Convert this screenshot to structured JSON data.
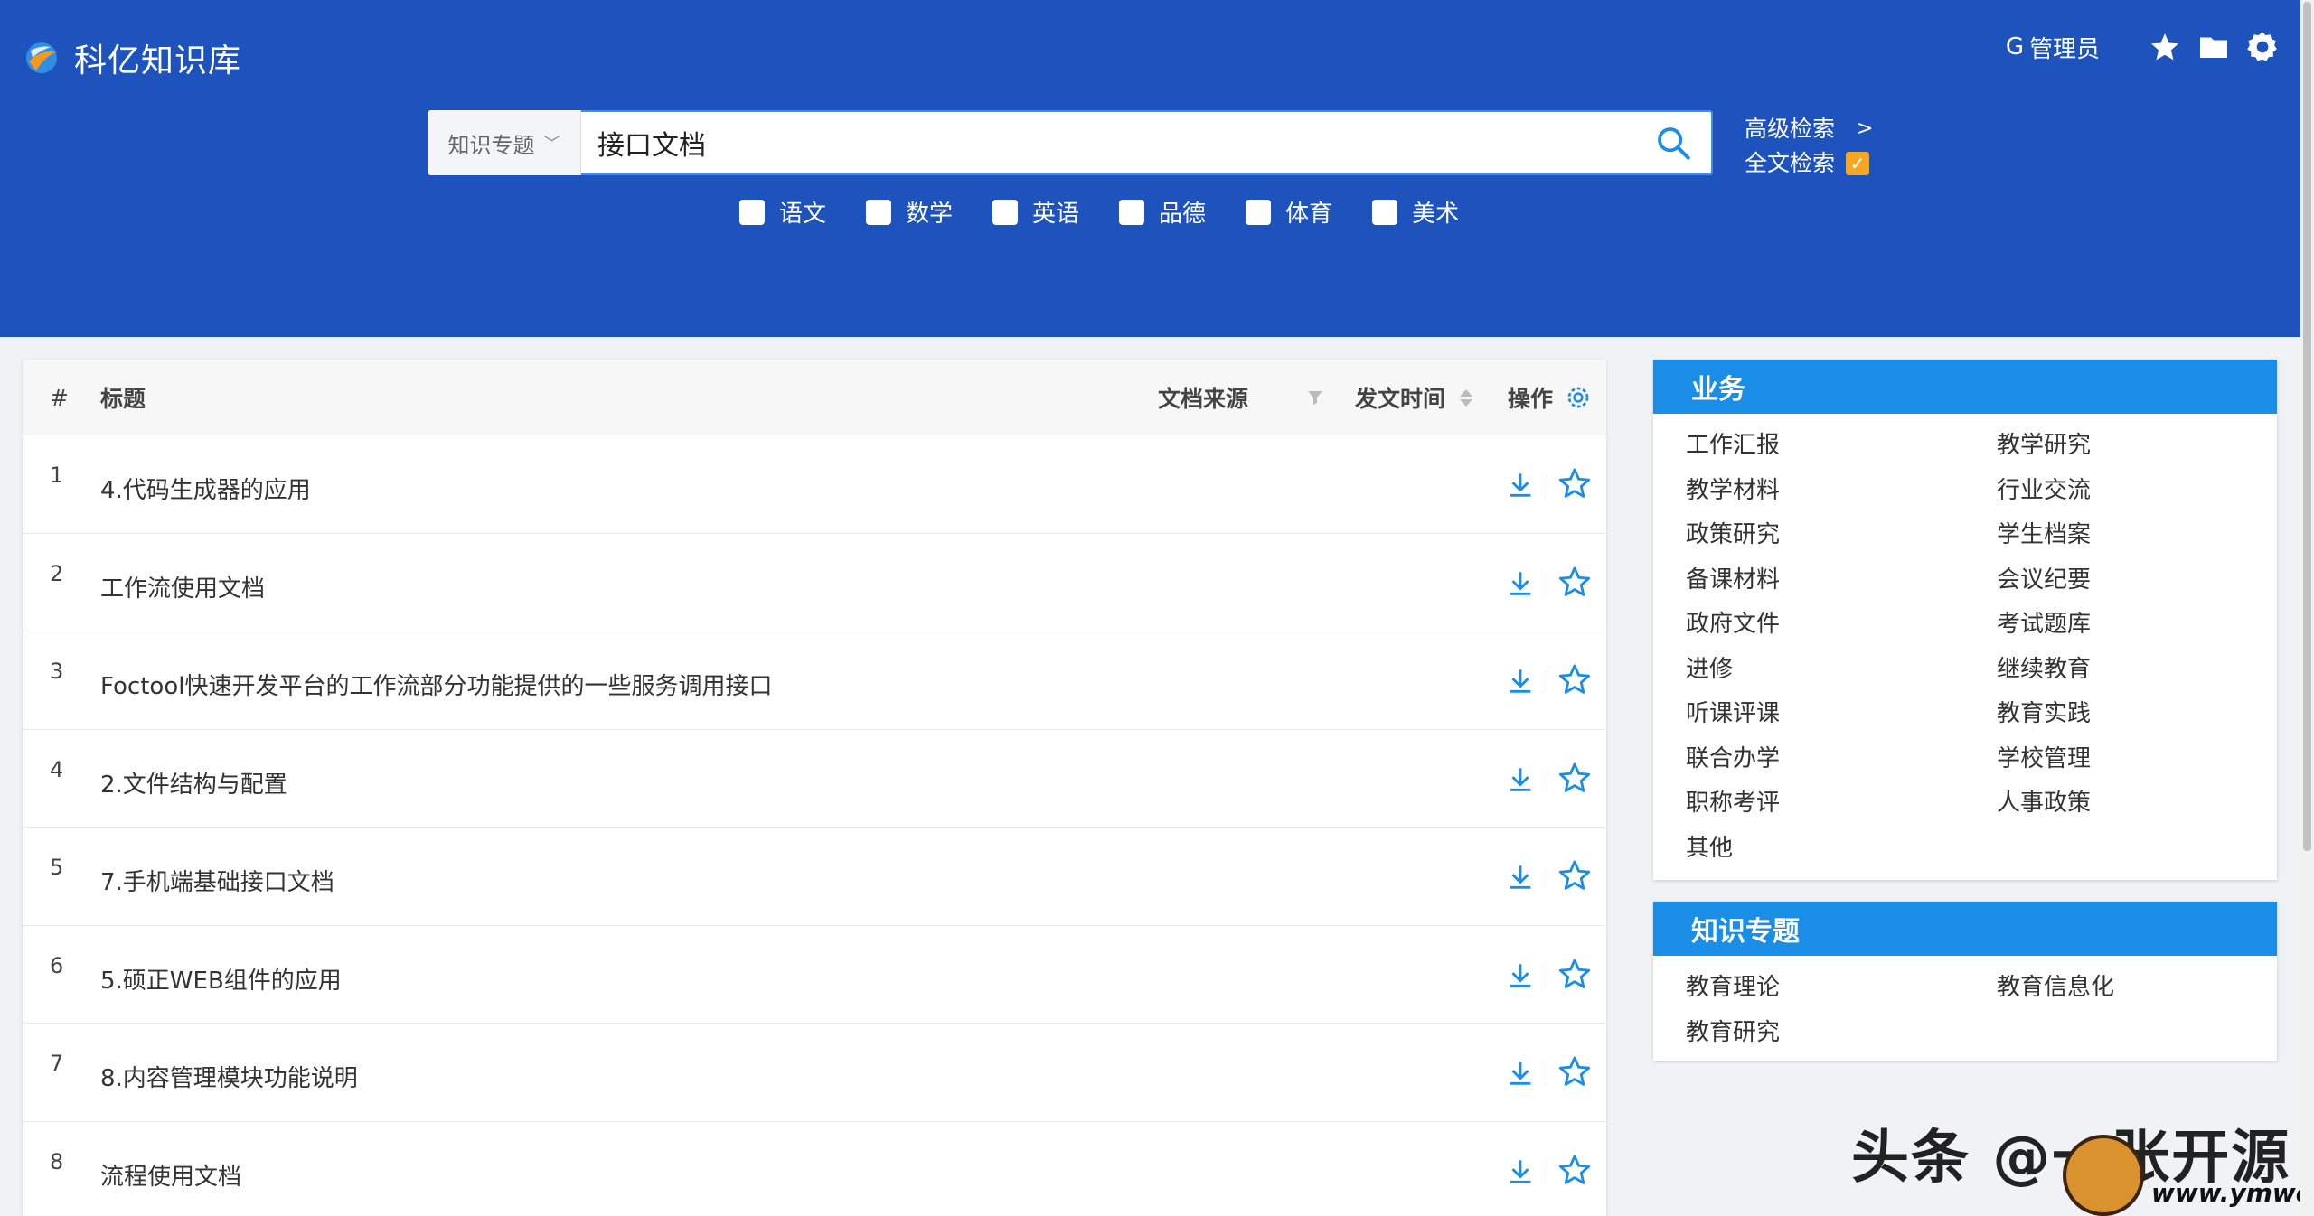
{
  "app": {
    "title": "科亿知识库"
  },
  "header": {
    "user_label": "管理员",
    "icons": [
      "star-icon",
      "folder-icon",
      "settings-icon"
    ]
  },
  "search": {
    "scope_label": "知识专题",
    "query": "接口文档",
    "advanced_label": "高级检索",
    "advanced_arrow": ">",
    "fulltext_label": "全文检索",
    "fulltext_checked": true
  },
  "subjects": [
    {
      "label": "语文",
      "checked": false
    },
    {
      "label": "数学",
      "checked": false
    },
    {
      "label": "英语",
      "checked": false
    },
    {
      "label": "品德",
      "checked": false
    },
    {
      "label": "体育",
      "checked": false
    },
    {
      "label": "美术",
      "checked": false
    }
  ],
  "table": {
    "columns": {
      "num": "#",
      "title": "标题",
      "source": "文档来源",
      "time": "发文时间",
      "ops": "操作"
    },
    "rows": [
      {
        "num": "1",
        "title": "4.代码生成器的应用"
      },
      {
        "num": "2",
        "title": "工作流使用文档"
      },
      {
        "num": "3",
        "title": "Foctool快速开发平台的工作流部分功能提供的一些服务调用接口"
      },
      {
        "num": "4",
        "title": "2.文件结构与配置"
      },
      {
        "num": "5",
        "title": "7.手机端基础接口文档"
      },
      {
        "num": "6",
        "title": "5.硕正WEB组件的应用"
      },
      {
        "num": "7",
        "title": "8.内容管理模块功能说明"
      },
      {
        "num": "8",
        "title": "流程使用文档"
      }
    ]
  },
  "business_panel": {
    "title": "业务",
    "items": [
      "工作汇报",
      "教学研究",
      "教学材料",
      "行业交流",
      "政策研究",
      "学生档案",
      "备课材料",
      "会议纪要",
      "政府文件",
      "考试题库",
      "进修",
      "继续教育",
      "听课评课",
      "教育实践",
      "联合办学",
      "学校管理",
      "职称考评",
      "人事政策",
      "其他"
    ]
  },
  "topic_panel": {
    "title": "知识专题",
    "items": [
      "教育理论",
      "教育信息化",
      "教育研究"
    ]
  },
  "watermark": {
    "text": "头条 @一张开源",
    "url": "www.ymwdcom"
  },
  "colors": {
    "header_bg": "#1e52bd",
    "panel_head": "#1a8de6",
    "icon_blue": "#1a8de6",
    "check_orange": "#f5a623"
  }
}
